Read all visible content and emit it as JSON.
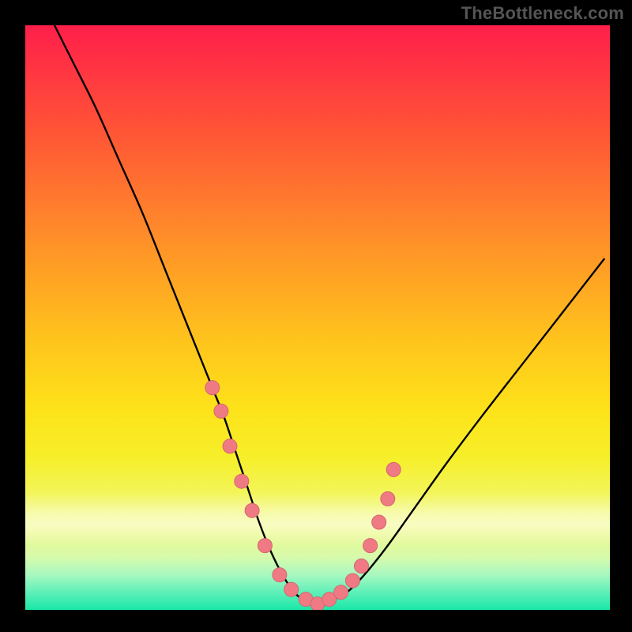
{
  "watermark": "TheBottleneck.com",
  "colors": {
    "curve_stroke": "#000000",
    "dot_fill": "#ef7a83",
    "dot_stroke": "#d46770"
  },
  "chart_data": {
    "type": "line",
    "title": "",
    "xlabel": "",
    "ylabel": "",
    "xlim": [
      0,
      100
    ],
    "ylim": [
      0,
      100
    ],
    "grid": false,
    "series": [
      {
        "name": "bottleneck-curve",
        "x": [
          5,
          8,
          12,
          16,
          20,
          24,
          28,
          30,
          32,
          34,
          36,
          38,
          40,
          42,
          44,
          46,
          48,
          50,
          52,
          55,
          58,
          62,
          67,
          72,
          78,
          85,
          92,
          99
        ],
        "y": [
          100,
          94,
          86,
          77,
          68,
          58,
          48,
          43,
          38,
          33,
          27,
          21,
          15,
          10,
          6,
          3,
          1.5,
          1,
          1.5,
          3,
          6,
          11,
          18,
          25,
          33,
          42,
          51,
          60
        ]
      }
    ],
    "dots": {
      "name": "highlighted-points",
      "x": [
        32,
        33.5,
        35,
        37,
        38.8,
        41,
        43.5,
        45.5,
        48,
        50,
        52,
        54,
        56,
        57.5,
        59,
        60.5,
        62,
        63
      ],
      "y": [
        38,
        34,
        28,
        22,
        17,
        11,
        6,
        3.5,
        1.8,
        1,
        1.8,
        3,
        5,
        7.5,
        11,
        15,
        19,
        24
      ]
    }
  }
}
